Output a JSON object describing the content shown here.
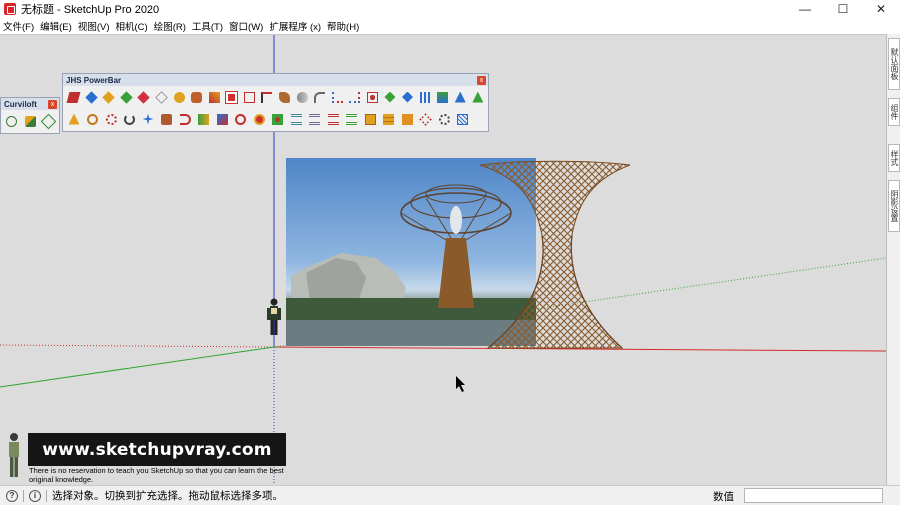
{
  "window": {
    "title": "无标题 - SketchUp Pro 2020",
    "controls": [
      "—",
      "☐",
      "✕"
    ]
  },
  "menu": [
    "文件(F)",
    "编辑(E)",
    "视图(V)",
    "相机(C)",
    "绘图(R)",
    "工具(T)",
    "窗口(W)",
    "扩展程序 (x)",
    "帮助(H)"
  ],
  "toolbars": {
    "curviloft": {
      "title": "Curviloft",
      "close": "x"
    },
    "jhs": {
      "title": "JHS PowerBar",
      "close": "x"
    }
  },
  "right_tabs": [
    "默认面板",
    "组件",
    "样式",
    "阴影设置"
  ],
  "watermark": {
    "url": "www.sketchupvray.com",
    "caption": "There is no reservation to teach you SketchUp so that you can learn the best original knowledge."
  },
  "status": {
    "message": "选择对象。切换到扩充选择。拖动鼠标选择多项。",
    "measurement_label": "数值",
    "measurement_value": ""
  },
  "colors": {
    "red_axis": "#d22b2b",
    "green_axis": "#2fa52f",
    "blue_axis": "#2b3bd2",
    "viewport_bg": "#dcdcdc",
    "tree_wood": "#8a5a2b"
  }
}
